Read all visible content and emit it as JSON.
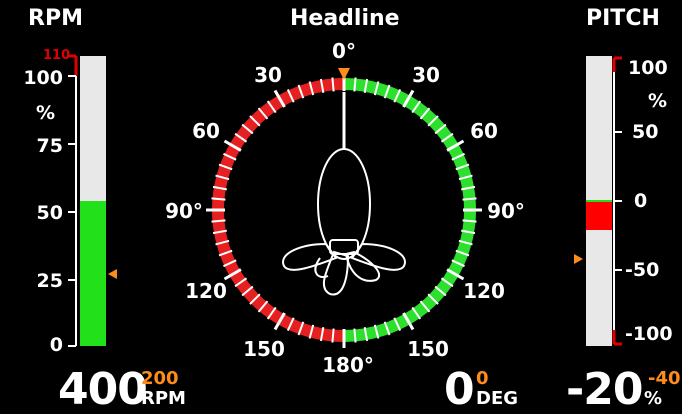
{
  "rpm": {
    "title": "RPM",
    "limit_label": "110",
    "unit_label": "%",
    "ticks": [
      "100",
      "75",
      "50",
      "25",
      "0"
    ],
    "fill_percent": 50,
    "setpoint_percent": 25,
    "value": "400",
    "target": "200",
    "unit": "RPM",
    "colors": {
      "fill": "#22e01a",
      "limit": "#e00000",
      "setpoint": "#ff8c1a"
    }
  },
  "headline": {
    "title": "Headline",
    "top_label": "0°",
    "bottom_label": "180°",
    "left_labels": [
      "30",
      "60",
      "90°",
      "120",
      "150"
    ],
    "right_labels": [
      "30",
      "60",
      "90°",
      "120",
      "150"
    ],
    "value": "0",
    "target": "0",
    "unit": "DEG",
    "colors": {
      "port": "#e62020",
      "starboard": "#2ee02e",
      "marker": "#ff8c1a"
    }
  },
  "pitch": {
    "title": "PITCH",
    "unit_label": "%",
    "ticks": [
      "100",
      "50",
      "0",
      "-50",
      "-100"
    ],
    "value_percent": -20,
    "setpoint_percent": -40,
    "value": "-20",
    "target": "-40",
    "unit": "%",
    "colors": {
      "fill": "#ff0000",
      "limit": "#e00000",
      "setpoint": "#ff8c1a"
    }
  }
}
